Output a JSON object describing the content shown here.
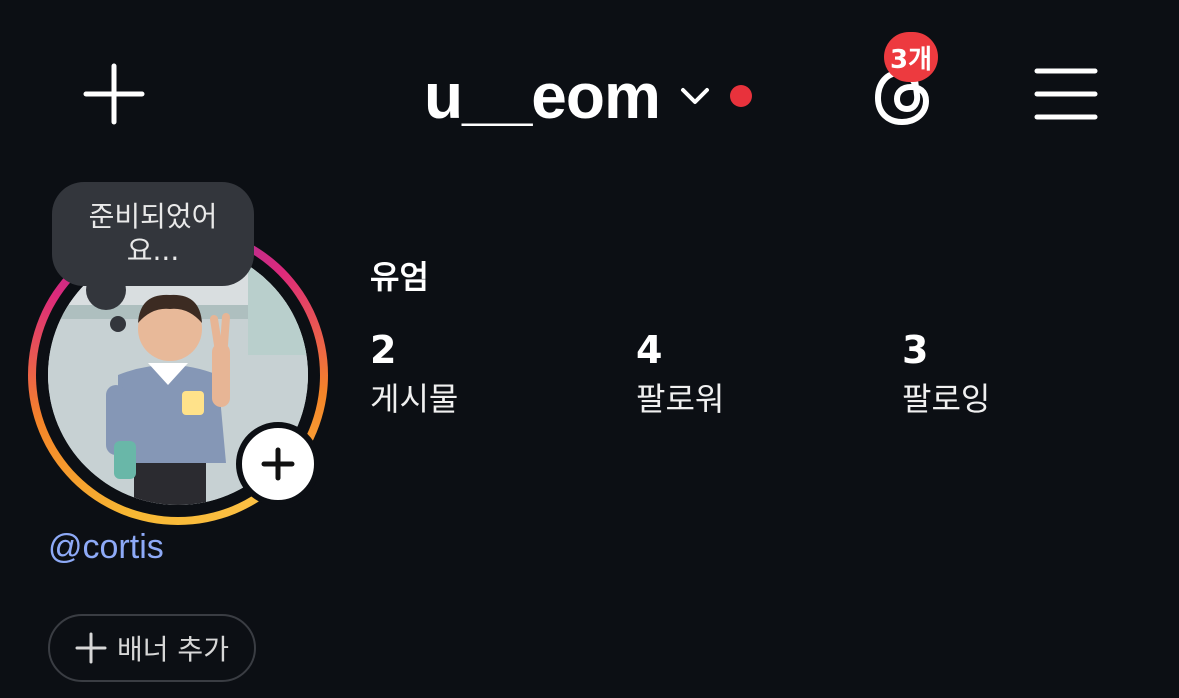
{
  "header": {
    "username": "u__eom",
    "threads_badge": "3개"
  },
  "profile": {
    "display_name": "유엄",
    "note": "준비되었어요...",
    "handle": "@cortis",
    "banner_button_label": "배너 추가",
    "stats": [
      {
        "value": "2",
        "label": "게시물"
      },
      {
        "value": "4",
        "label": "팔로워"
      },
      {
        "value": "3",
        "label": "팔로잉"
      }
    ]
  },
  "colors": {
    "background": "#0c0f14",
    "badge": "#ed3a3f",
    "handle_link": "#8eaaf7"
  },
  "icons": [
    "plus-icon",
    "chevron-down-icon",
    "threads-icon",
    "menu-icon"
  ]
}
